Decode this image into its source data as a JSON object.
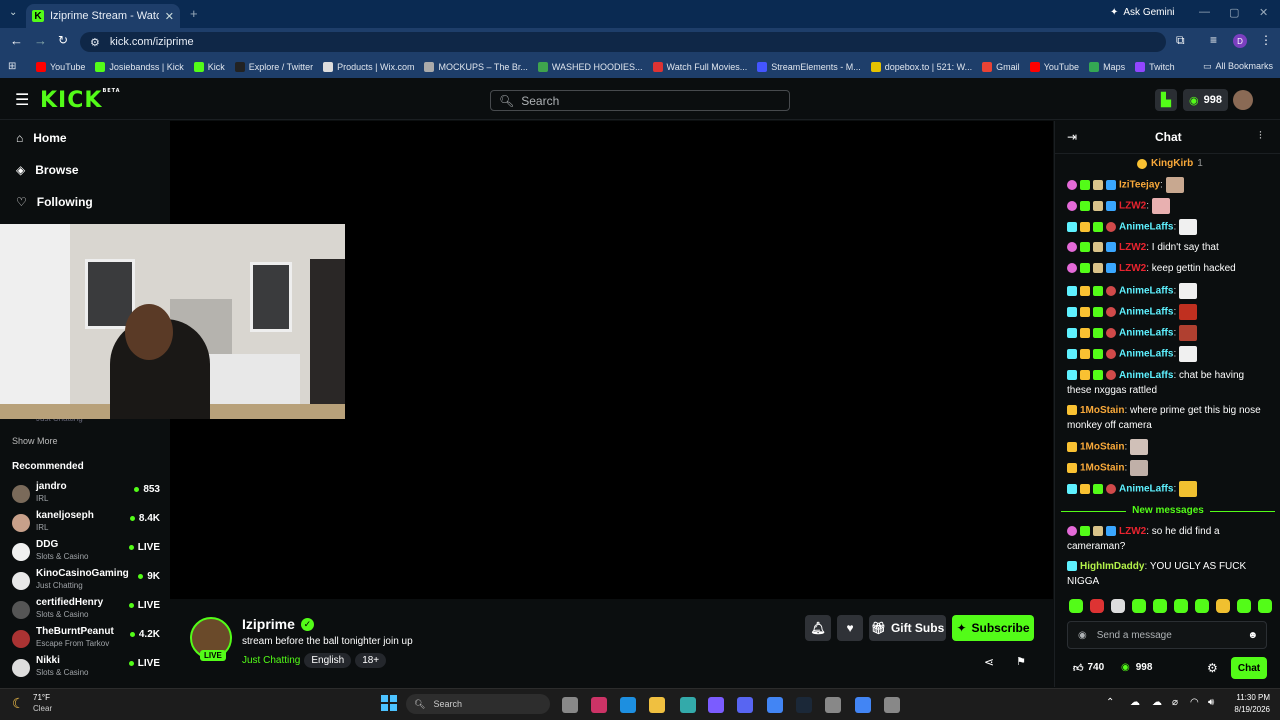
{
  "browser": {
    "tab_title": "Iziprime Stream - Watch Live on",
    "url": "kick.com/iziprime",
    "ask_gemini": "Ask Gemini",
    "profile_initial": "D",
    "bookmarks": [
      "YouTube",
      "Josiebandss | Kick",
      "Kick",
      "Explore / Twitter",
      "Products | Wix.com",
      "MOCKUPS – The Br...",
      "WASHED HOODIES...",
      "Watch Full Movies...",
      "StreamElements - M...",
      "dopebox.to | 521: W...",
      "Gmail",
      "YouTube",
      "Maps",
      "Twitch"
    ],
    "all_bookmarks": "All Bookmarks"
  },
  "header": {
    "logo": "KICK",
    "logo_beta": "BETA",
    "search_placeholder": "Search",
    "points": "998"
  },
  "sidebar": {
    "nav": [
      "Home",
      "Browse",
      "Following"
    ],
    "following_partial_cat": "Just Chatting",
    "show_more": "Show More",
    "recommended_title": "Recommended",
    "recommended": [
      {
        "name": "jandro",
        "category": "IRL",
        "viewers": "853"
      },
      {
        "name": "kaneljoseph",
        "category": "IRL",
        "viewers": "8.4K"
      },
      {
        "name": "DDG",
        "category": "Slots & Casino",
        "viewers": "LIVE"
      },
      {
        "name": "KinoCasinoGaming",
        "category": "Just Chatting",
        "viewers": "9K"
      },
      {
        "name": "certifiedHenry",
        "category": "Slots & Casino",
        "viewers": "LIVE"
      },
      {
        "name": "TheBurntPeanut",
        "category": "Escape From Tarkov",
        "viewers": "4.2K"
      },
      {
        "name": "Nikki",
        "category": "Slots & Casino",
        "viewers": "LIVE"
      }
    ]
  },
  "stream": {
    "channel": "Iziprime",
    "live_badge": "LIVE",
    "title": "stream before the ball tonighter join up",
    "category": "Just Chatting",
    "tags": [
      "English",
      "18+"
    ],
    "gift_subs": "Gift Subs",
    "subscribe": "Subscribe"
  },
  "chat": {
    "title": "Chat",
    "pinned_user": "KingKirb",
    "pinned_count": "1",
    "new_messages": "New messages",
    "messages": [
      {
        "user": "IziTeejay",
        "text": "",
        "color": "#f9a93a"
      },
      {
        "user": "LZW2",
        "text": "",
        "color": "#e8232f"
      },
      {
        "user": "AnimeLaffs",
        "text": "",
        "color": "#5ef1ff"
      },
      {
        "user": "LZW2",
        "text": "I didn't say that",
        "color": "#e8232f"
      },
      {
        "user": "LZW2",
        "text": "keep gettin hacked",
        "color": "#e8232f"
      },
      {
        "user": "AnimeLaffs",
        "text": "",
        "color": "#5ef1ff"
      },
      {
        "user": "AnimeLaffs",
        "text": "",
        "color": "#5ef1ff"
      },
      {
        "user": "AnimeLaffs",
        "text": "",
        "color": "#5ef1ff"
      },
      {
        "user": "AnimeLaffs",
        "text": "",
        "color": "#5ef1ff"
      },
      {
        "user": "AnimeLaffs",
        "text": "chat be having these nxggas rattled",
        "color": "#5ef1ff"
      },
      {
        "user": "1MoStain",
        "text": "where prime get this big nose monkey off camera",
        "color": "#f9a93a"
      },
      {
        "user": "1MoStain",
        "text": "",
        "color": "#f9a93a"
      },
      {
        "user": "1MoStain",
        "text": "",
        "color": "#f9a93a"
      },
      {
        "user": "AnimeLaffs",
        "text": "",
        "color": "#5ef1ff"
      },
      {
        "user": "LZW2",
        "text": "so he did find a cameraman?",
        "color": "#e8232f"
      },
      {
        "user": "HighImDaddy",
        "text": "YOU UGLY AS FUCK NIGGA",
        "color": "#b4f24a"
      }
    ],
    "input_placeholder": "Send a message",
    "likes": "740",
    "points": "998",
    "send_label": "Chat"
  },
  "taskbar": {
    "weather_temp": "71°F",
    "weather_desc": "Clear",
    "search_placeholder": "Search",
    "time": "11:30 PM",
    "date": "8/19/2026"
  }
}
